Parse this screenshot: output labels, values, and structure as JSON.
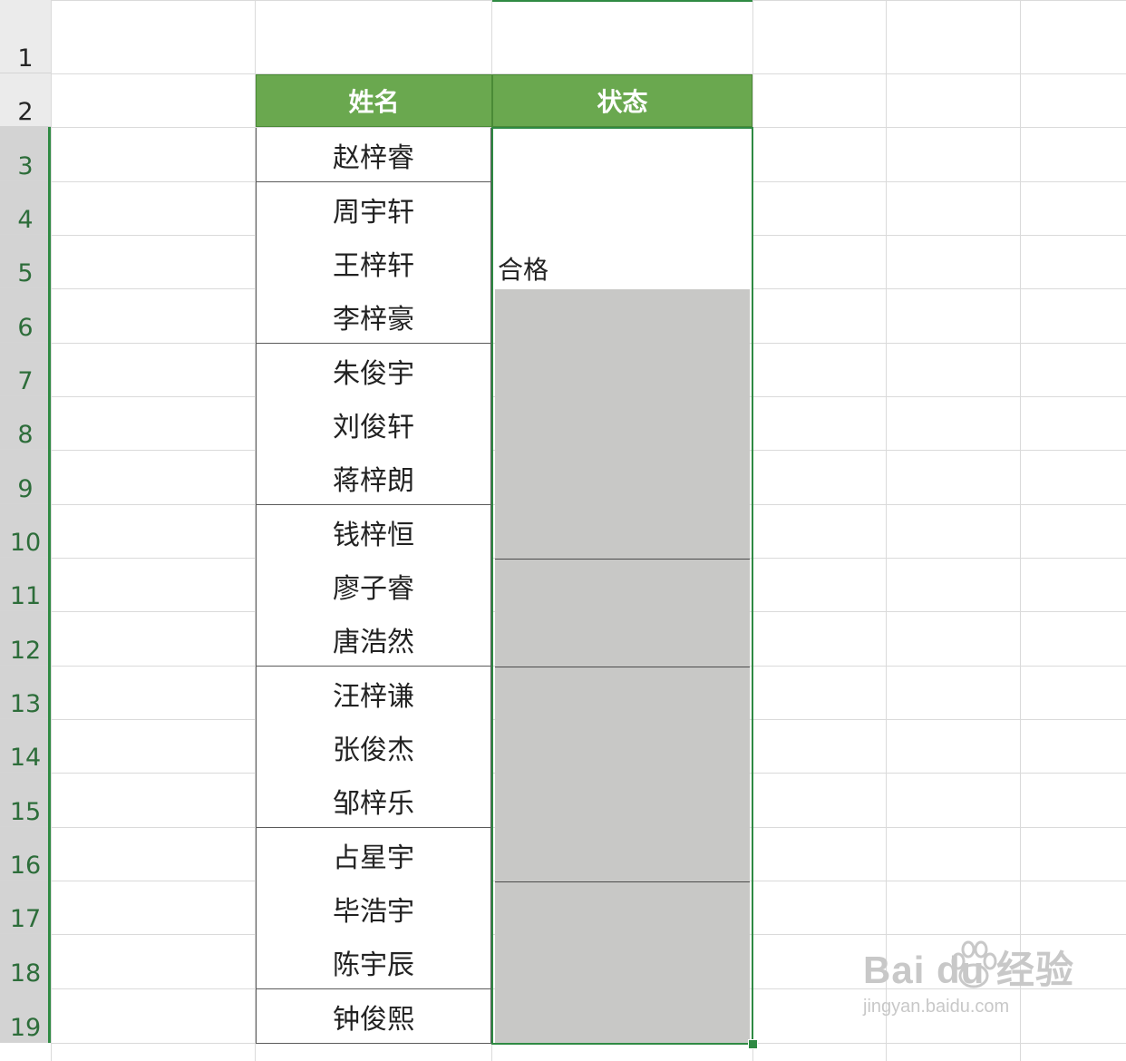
{
  "rows": [
    "1",
    "2",
    "3",
    "4",
    "5",
    "6",
    "7",
    "8",
    "9",
    "10",
    "11",
    "12",
    "13",
    "14",
    "15",
    "16",
    "17",
    "18",
    "19"
  ],
  "table": {
    "headers": {
      "name": "姓名",
      "status": "状态"
    },
    "names": [
      "赵梓睿",
      "周宇轩",
      "王梓轩",
      "李梓豪",
      "朱俊宇",
      "刘俊轩",
      "蒋梓朗",
      "钱梓恒",
      "廖子睿",
      "唐浩然",
      "汪梓谦",
      "张俊杰",
      "邹梓乐",
      "占星宇",
      "毕浩宇",
      "陈宇辰",
      "钟俊熙"
    ],
    "status_value": "合格"
  },
  "colors": {
    "header_green": "#6aa84f",
    "selection_green": "#2f8a43",
    "merged_gray": "#c8c8c6"
  },
  "watermark": {
    "logo": "Bai du 经验",
    "url": "jingyan.baidu.com"
  }
}
